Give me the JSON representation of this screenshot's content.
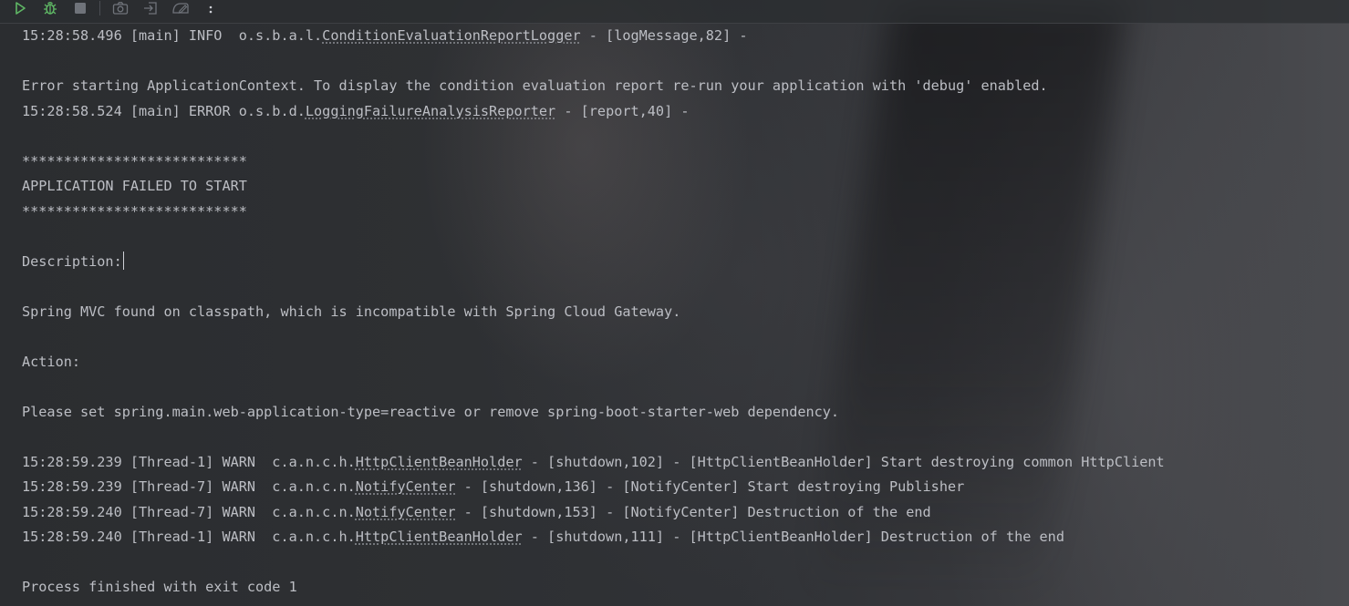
{
  "toolbar": {
    "buttons": [
      {
        "icon": "run-icon",
        "color": "#5fb865"
      },
      {
        "icon": "debug-icon",
        "color": "#5fb865"
      },
      {
        "icon": "stop-icon",
        "color": "#6f737a"
      },
      {
        "icon": "camera-icon",
        "color": "#6f737a"
      },
      {
        "icon": "restore-layout-icon",
        "color": "#6f737a"
      },
      {
        "icon": "edit-config-icon",
        "color": "#6f737a"
      },
      {
        "icon": "more-options-icon",
        "color": "#ced0d6"
      }
    ]
  },
  "console": {
    "lines": [
      {
        "pre": "15:28:58.496 [main] INFO  o.s.b.a.l.",
        "link": "ConditionEvaluationReportLogger",
        "post": " - [logMessage,82] -"
      },
      {
        "pre": "",
        "link": "",
        "post": ""
      },
      {
        "pre": "Error starting ApplicationContext. To display the condition evaluation report re-run your application with 'debug' enabled.",
        "link": "",
        "post": ""
      },
      {
        "pre": "15:28:58.524 [main] ERROR o.s.b.d.",
        "link": "LoggingFailureAnalysisReporter",
        "post": " - [report,40] -"
      },
      {
        "pre": "",
        "link": "",
        "post": ""
      },
      {
        "pre": "***************************",
        "link": "",
        "post": ""
      },
      {
        "pre": "APPLICATION FAILED TO START",
        "link": "",
        "post": ""
      },
      {
        "pre": "***************************",
        "link": "",
        "post": ""
      },
      {
        "pre": "",
        "link": "",
        "post": ""
      },
      {
        "pre": "Description:",
        "link": "",
        "post": "",
        "caret": true
      },
      {
        "pre": "",
        "link": "",
        "post": ""
      },
      {
        "pre": "Spring MVC found on classpath, which is incompatible with Spring Cloud Gateway.",
        "link": "",
        "post": ""
      },
      {
        "pre": "",
        "link": "",
        "post": ""
      },
      {
        "pre": "Action:",
        "link": "",
        "post": ""
      },
      {
        "pre": "",
        "link": "",
        "post": ""
      },
      {
        "pre": "Please set spring.main.web-application-type=reactive or remove spring-boot-starter-web dependency.",
        "link": "",
        "post": ""
      },
      {
        "pre": "",
        "link": "",
        "post": ""
      },
      {
        "pre": "15:28:59.239 [Thread-1] WARN  c.a.n.c.h.",
        "link": "HttpClientBeanHolder",
        "post": " - [shutdown,102] - [HttpClientBeanHolder] Start destroying common HttpClient"
      },
      {
        "pre": "15:28:59.239 [Thread-7] WARN  c.a.n.c.n.",
        "link": "NotifyCenter",
        "post": " - [shutdown,136] - [NotifyCenter] Start destroying Publisher"
      },
      {
        "pre": "15:28:59.240 [Thread-7] WARN  c.a.n.c.n.",
        "link": "NotifyCenter",
        "post": " - [shutdown,153] - [NotifyCenter] Destruction of the end"
      },
      {
        "pre": "15:28:59.240 [Thread-1] WARN  c.a.n.c.h.",
        "link": "HttpClientBeanHolder",
        "post": " - [shutdown,111] - [HttpClientBeanHolder] Destruction of the end"
      },
      {
        "pre": "",
        "link": "",
        "post": ""
      },
      {
        "pre": "Process finished with exit code 1",
        "link": "",
        "post": ""
      }
    ]
  }
}
